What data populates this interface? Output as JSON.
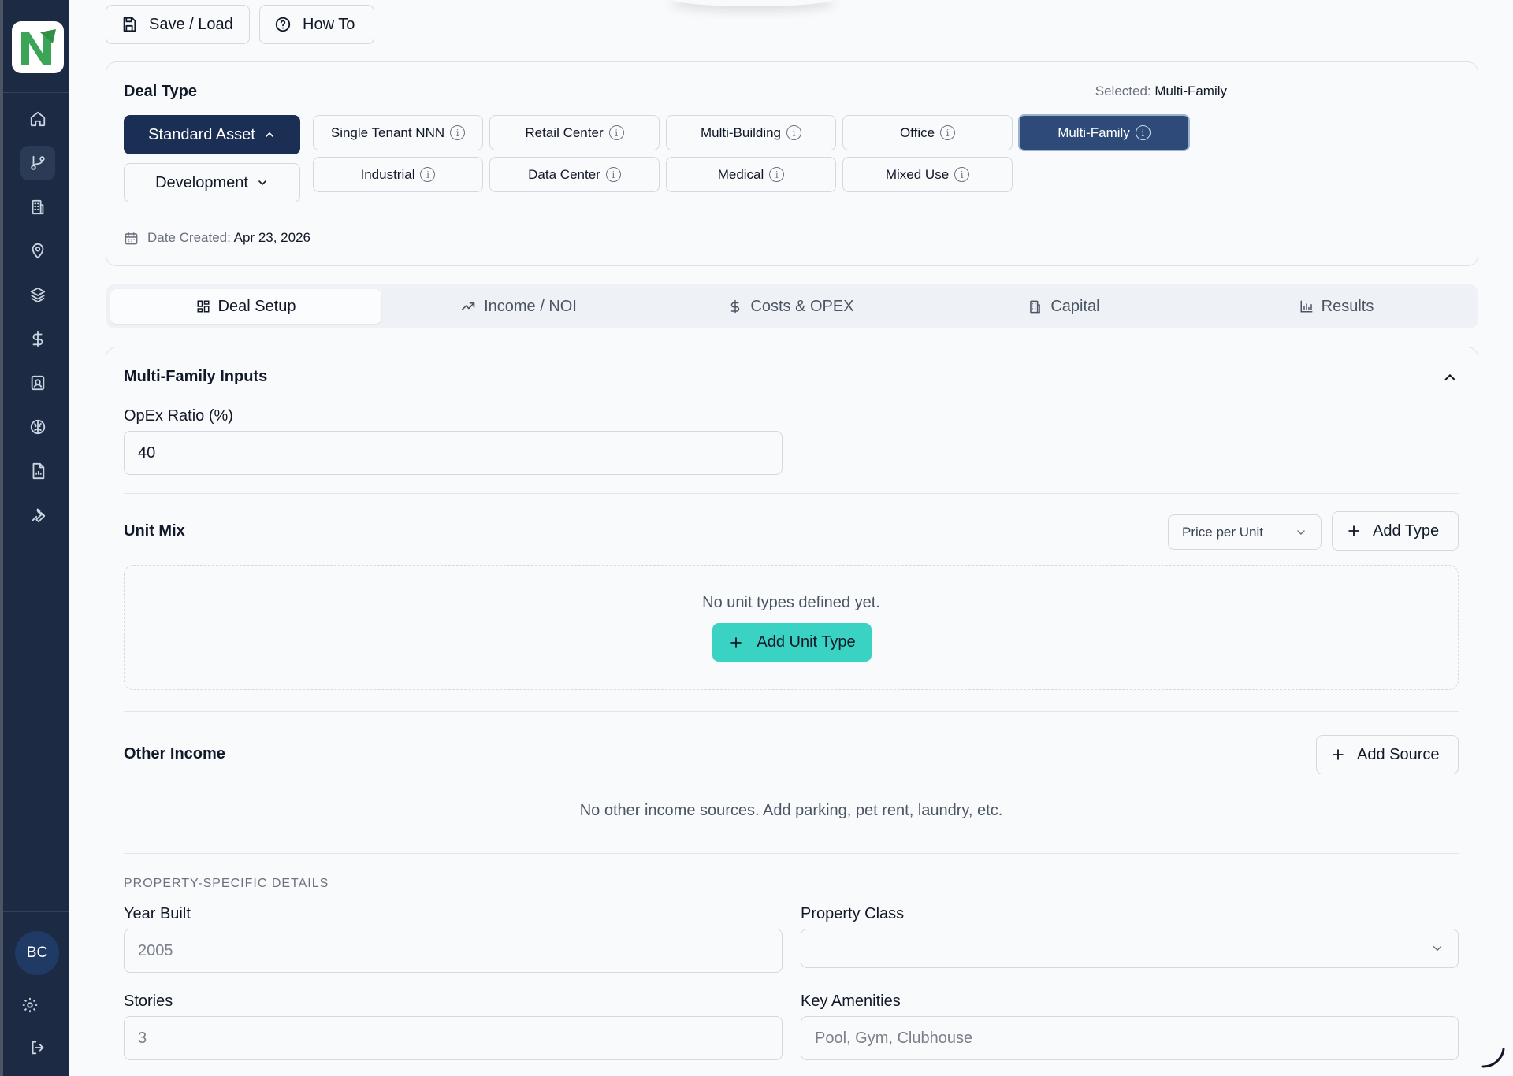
{
  "toolbar": {
    "save_load": "Save / Load",
    "how_to": "How To"
  },
  "deal_type": {
    "title": "Deal Type",
    "selected_label": "Selected:",
    "selected_value": "Multi-Family",
    "standard_asset": "Standard Asset",
    "development": "Development",
    "types": [
      "Single Tenant NNN",
      "Retail Center",
      "Multi-Building",
      "Office",
      "Multi-Family",
      "Industrial",
      "Data Center",
      "Medical",
      "Mixed Use"
    ],
    "date_label": "Date Created:",
    "date_value": "Apr 23, 2026"
  },
  "tabs": [
    "Deal Setup",
    "Income / NOI",
    "Costs & OPEX",
    "Capital",
    "Results"
  ],
  "inputs": {
    "title": "Multi-Family Inputs",
    "opex_label": "OpEx Ratio (%)",
    "opex_value": "40",
    "unit_mix_title": "Unit Mix",
    "price_mode": "Price per Unit",
    "add_type": "Add Type",
    "no_units": "No unit types defined yet.",
    "add_unit_type": "Add Unit Type",
    "other_income_title": "Other Income",
    "add_source": "Add Source",
    "no_income": "No other income sources. Add parking, pet rent, laundry, etc.",
    "property_details": "PROPERTY-SPECIFIC DETAILS",
    "year_built_label": "Year Built",
    "year_built_placeholder": "2005",
    "property_class_label": "Property Class",
    "property_class_value": "",
    "stories_label": "Stories",
    "stories_placeholder": "3",
    "amenities_label": "Key Amenities",
    "amenities_placeholder": "Pool, Gym, Clubhouse"
  },
  "user": {
    "initials": "BC"
  },
  "colors": {
    "sidebar": "#1c2a44",
    "primary": "#1b2f55",
    "selected_chip": "#2d4a78",
    "teal": "#3ad3c3"
  },
  "sidebar_icons": [
    "home-icon",
    "git-branch-icon",
    "building-icon",
    "map-pin-icon",
    "layers-icon",
    "dollar-icon",
    "contact-icon",
    "brain-icon",
    "report-icon",
    "wrench-icon",
    "settings-icon",
    "logout-icon"
  ]
}
